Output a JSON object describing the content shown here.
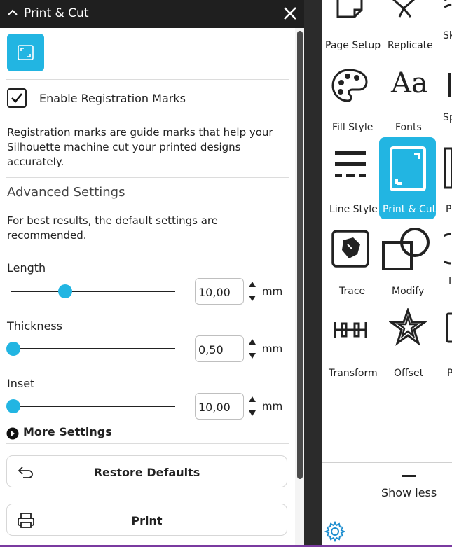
{
  "panel": {
    "title": "Print & Cut",
    "enable_label": "Enable Registration Marks",
    "enabled": true,
    "description_lines": [
      "Registration marks are guide marks that help your",
      "Silhouette machine cut your printed designs",
      "accurately."
    ],
    "advanced_title": "Advanced Settings",
    "advanced_desc_lines": [
      "For best results, the default settings are",
      "recommended."
    ],
    "length": {
      "label": "Length",
      "value": "10,00",
      "unit": "mm",
      "level": 0.35
    },
    "thickness": {
      "label": "Thickness",
      "value": "0,50",
      "unit": "mm",
      "level": 0.0
    },
    "inset": {
      "label": "Inset",
      "value": "10,00",
      "unit": "mm",
      "level": 0.0
    },
    "more_settings": "More Settings",
    "restore_label": "Restore Defaults",
    "print_label": "Print"
  },
  "tools": {
    "row1": [
      "Page Setup",
      "Replicate",
      "Sk"
    ],
    "row2": [
      "Fill Style",
      "Fonts",
      "Sp"
    ],
    "row3": [
      "Line Style",
      "Print & Cut",
      "P"
    ],
    "row4": [
      "Trace",
      "Modify",
      "I"
    ],
    "row5": [
      "Transform",
      "Offset",
      "P"
    ],
    "show_less": "Show less"
  },
  "colors": {
    "accent": "#22b5e2",
    "header": "#1f1f1f"
  }
}
